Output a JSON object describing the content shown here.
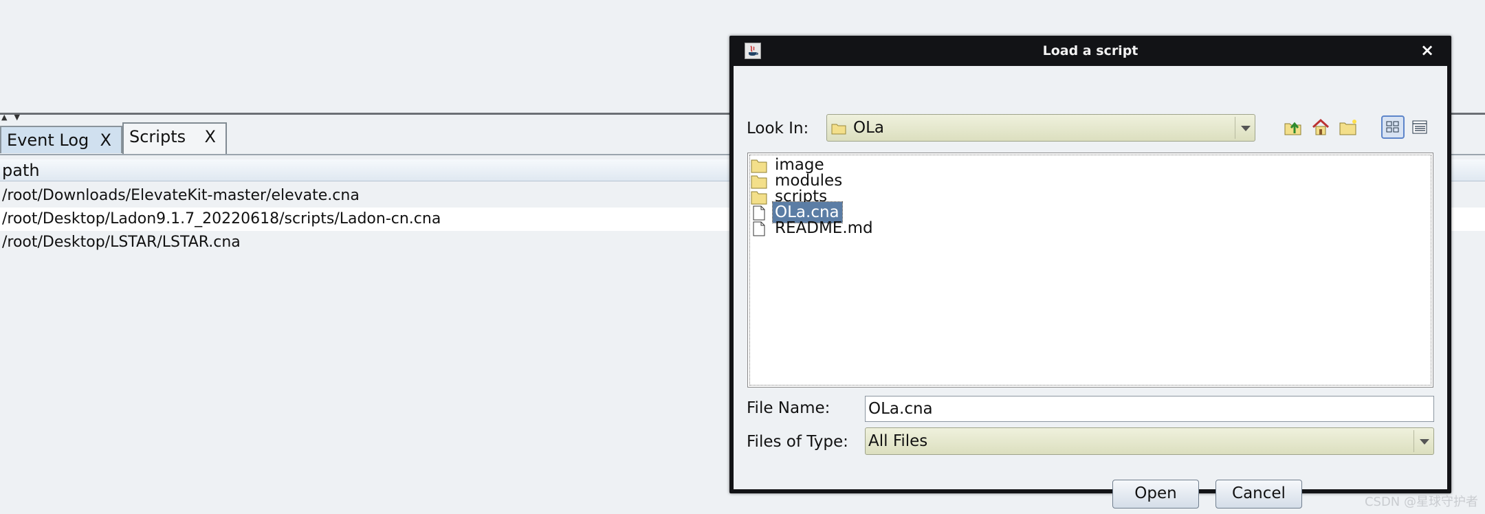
{
  "background": {
    "tabs": [
      {
        "label": "Event Log",
        "close": "X"
      },
      {
        "label": "Scripts",
        "close": "X"
      }
    ],
    "table": {
      "header": "path",
      "rows": [
        "/root/Downloads/ElevateKit-master/elevate.cna",
        "/root/Desktop/Ladon9.1.7_20220618/scripts/Ladon-cn.cna",
        "/root/Desktop/LSTAR/LSTAR.cna"
      ]
    }
  },
  "dialog": {
    "title": "Load a script",
    "close": "×",
    "look_in": {
      "label": "Look In:",
      "value": "OLa"
    },
    "files": [
      {
        "name": "image",
        "icon": "folder-icon"
      },
      {
        "name": "modules",
        "icon": "folder-icon"
      },
      {
        "name": "scripts",
        "icon": "folder-icon"
      },
      {
        "name": "OLa.cna",
        "icon": "file-icon",
        "selected": true
      },
      {
        "name": "README.md",
        "icon": "file-icon"
      }
    ],
    "file_name": {
      "label": "File Name:",
      "value": "OLa.cna"
    },
    "file_type": {
      "label": "Files of Type:",
      "value": "All Files"
    },
    "buttons": {
      "open": "Open",
      "cancel": "Cancel"
    }
  },
  "watermark": "CSDN @星球守护者",
  "colors": {
    "selection": "#5b7da5",
    "combo": "#dcdfbf",
    "titlebar": "#121316"
  }
}
